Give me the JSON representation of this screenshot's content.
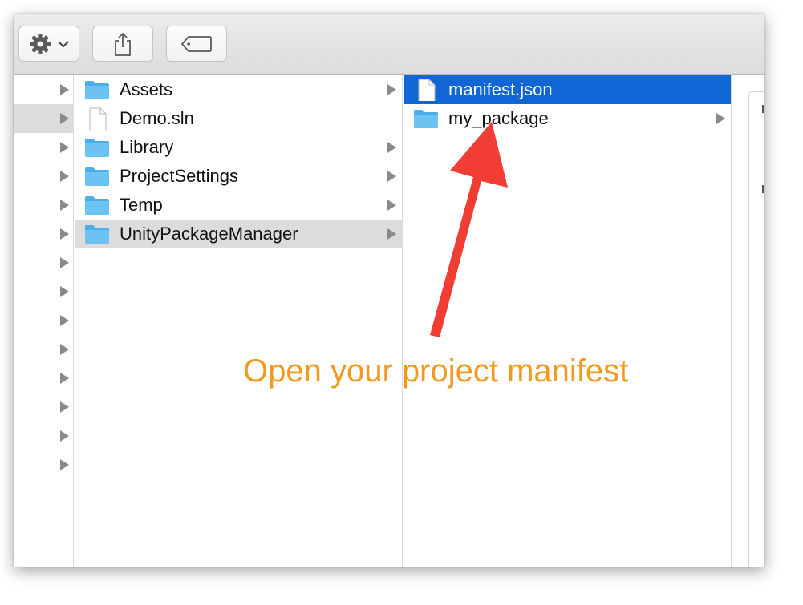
{
  "toolbar": {
    "buttons": [
      {
        "icon": "gear-icon",
        "has_dropdown": true
      },
      {
        "icon": "share-icon"
      },
      {
        "icon": "tag-icon"
      }
    ]
  },
  "columns": {
    "parent_rows": 14,
    "project": [
      {
        "label": "Assets",
        "type": "folder",
        "expandable": true,
        "selected": false
      },
      {
        "label": "Demo.sln",
        "type": "file",
        "expandable": false,
        "selected": false
      },
      {
        "label": "Library",
        "type": "folder",
        "expandable": true,
        "selected": false
      },
      {
        "label": "ProjectSettings",
        "type": "folder",
        "expandable": true,
        "selected": false
      },
      {
        "label": "Temp",
        "type": "folder",
        "expandable": true,
        "selected": false
      },
      {
        "label": "UnityPackageManager",
        "type": "folder",
        "expandable": true,
        "selected": true
      }
    ],
    "package_manager": [
      {
        "label": "manifest.json",
        "type": "file",
        "expandable": false,
        "selected": true
      },
      {
        "label": "my_package",
        "type": "folder",
        "expandable": true,
        "selected": false
      }
    ]
  },
  "annotation": {
    "text": "Open your project manifest",
    "color": "#f29a1f",
    "arrow_color": "#f13d33"
  },
  "colors": {
    "selection_blue": "#1166d6",
    "selection_grey": "#dcdcdc",
    "folder_blue": "#6cc3f2"
  }
}
